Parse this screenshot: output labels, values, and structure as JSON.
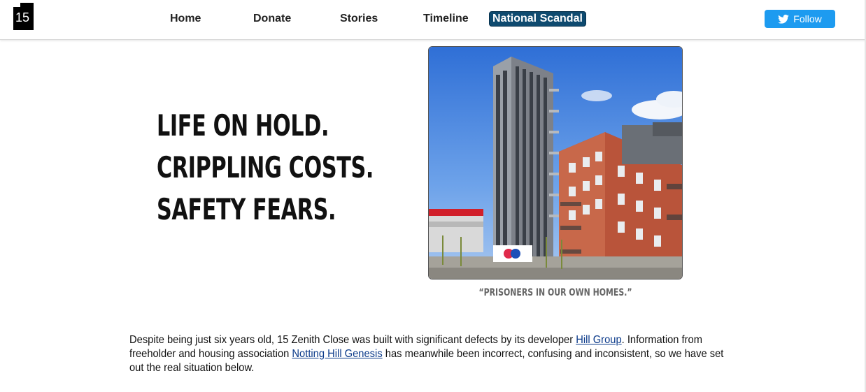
{
  "header": {
    "logo_text": "15",
    "nav": [
      {
        "label": "Home"
      },
      {
        "label": "Donate"
      },
      {
        "label": "Stories"
      },
      {
        "label": "Timeline"
      },
      {
        "label": "National Scandal",
        "active": true
      }
    ],
    "follow_label": "Follow"
  },
  "hero": {
    "lines": [
      "LIFE ON HOLD.",
      "CRIPPLING COSTS.",
      "SAFETY FEARS."
    ],
    "caption": "“PRISONERS IN OUR OWN HOMES.”"
  },
  "intro": {
    "text1": "Despite being just six years old, 15 Zenith Close was built with significant defects by its developer ",
    "link1": "Hill Group",
    "text2": ". Information from freeholder and housing association ",
    "link2": "Notting Hill Genesis",
    "text3": " has meanwhile been incorrect, confusing and inconsistent, so we have set out the real situation below."
  },
  "colors": {
    "active_nav": "#0e4a6f",
    "follow": "#1d9bf0",
    "link": "#0b3a8a"
  },
  "icons": {
    "follow": "bird-icon"
  }
}
